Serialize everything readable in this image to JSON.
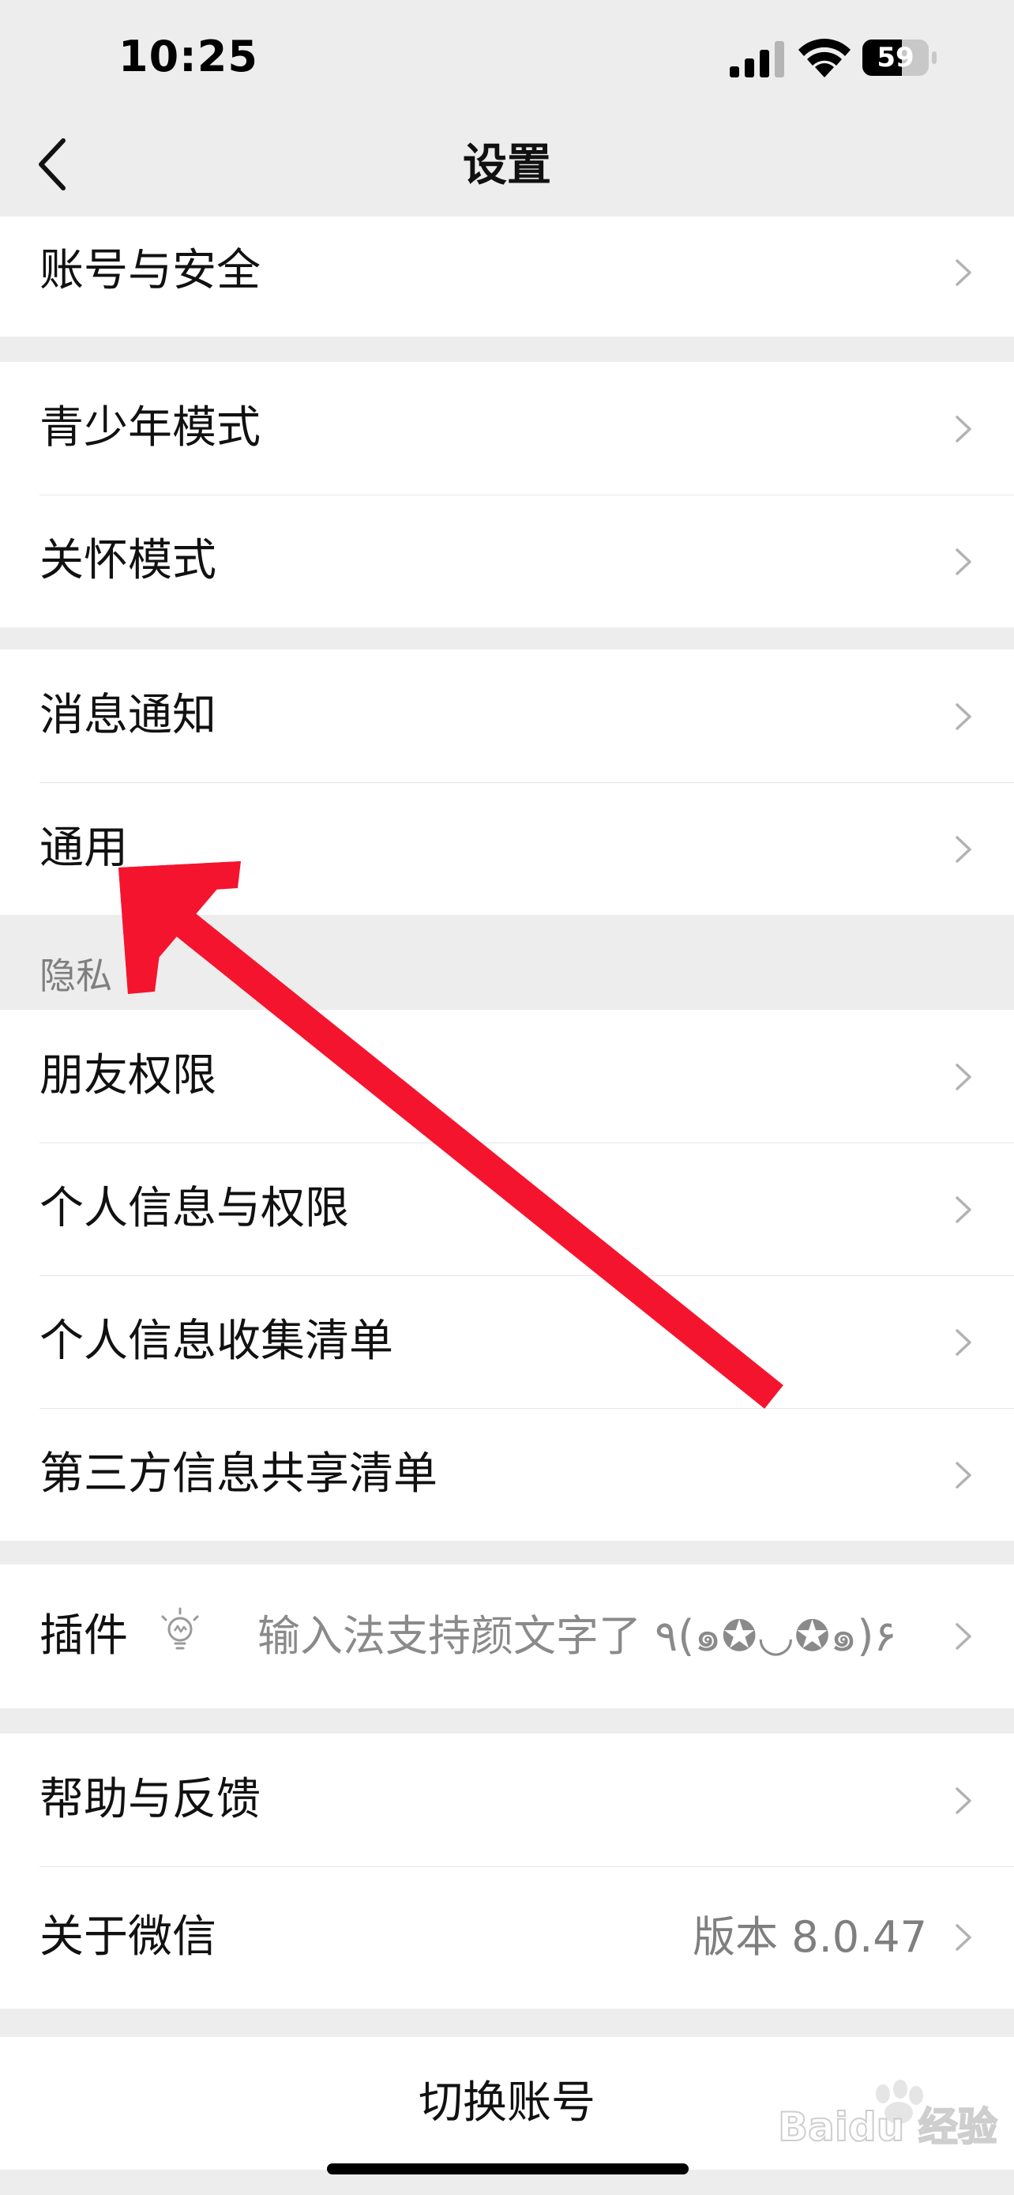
{
  "status_bar": {
    "time": "10:25",
    "battery": "59"
  },
  "nav": {
    "title": "设置"
  },
  "groups": {
    "account": {
      "items": [
        {
          "label": "账号与安全"
        }
      ]
    },
    "modes": {
      "items": [
        {
          "label": "青少年模式"
        },
        {
          "label": "关怀模式"
        }
      ]
    },
    "general": {
      "items": [
        {
          "label": "消息通知"
        },
        {
          "label": "通用"
        }
      ]
    },
    "privacy": {
      "header": "隐私",
      "items": [
        {
          "label": "朋友权限"
        },
        {
          "label": "个人信息与权限"
        },
        {
          "label": "个人信息收集清单"
        },
        {
          "label": "第三方信息共享清单"
        }
      ]
    },
    "plugins": {
      "label": "插件",
      "hint": "输入法支持颜文字了 ٩(๑✪◡✪๑)۶"
    },
    "about": {
      "items": [
        {
          "label": "帮助与反馈"
        },
        {
          "label": "关于微信",
          "value": "版本 8.0.47"
        }
      ]
    }
  },
  "switch_account": {
    "label": "切换账号"
  },
  "watermark": {
    "text": "Baidu 经验"
  },
  "colors": {
    "background": "#ededed",
    "cell": "#ffffff",
    "arrow": "#f5142e",
    "secondary_text": "#7f7f7f"
  }
}
